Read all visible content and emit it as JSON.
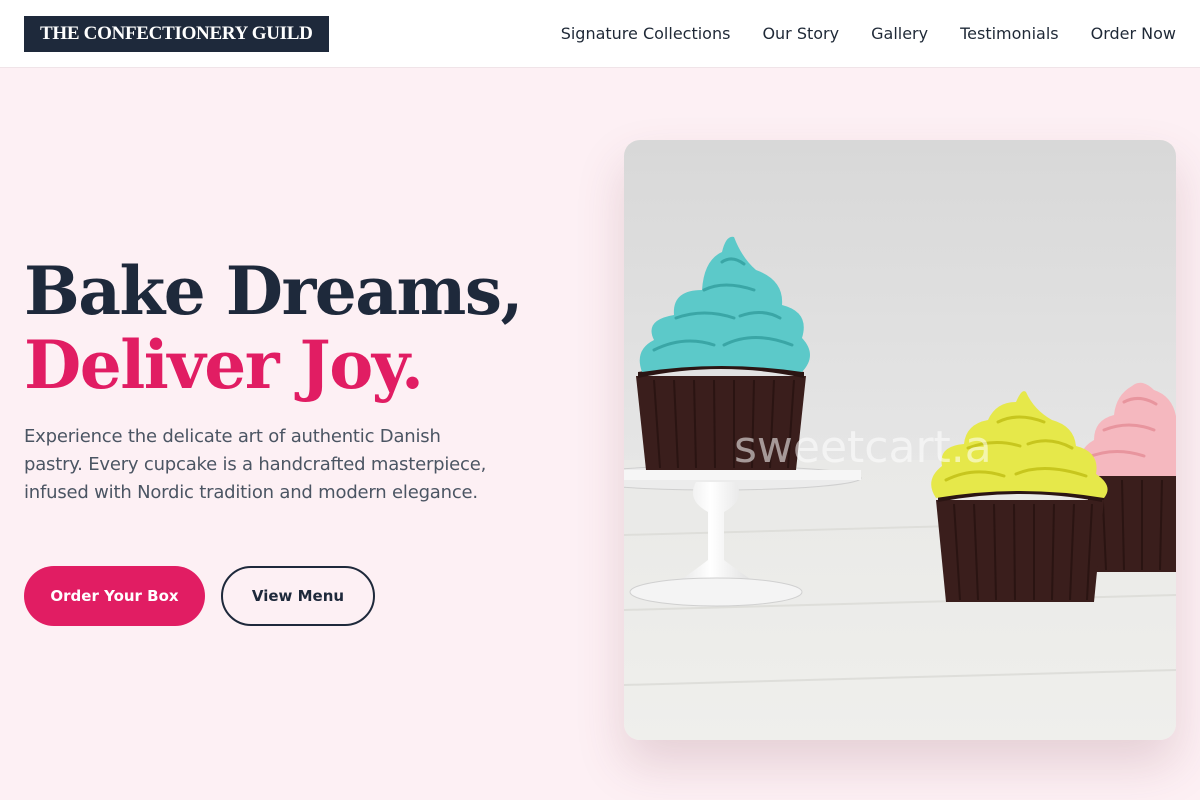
{
  "header": {
    "brand": "THE CONFECTIONERY GUILD",
    "nav": [
      {
        "label": "Signature Collections"
      },
      {
        "label": "Our Story"
      },
      {
        "label": "Gallery"
      },
      {
        "label": "Testimonials"
      },
      {
        "label": "Order Now"
      }
    ]
  },
  "hero": {
    "title_line1": "Bake Dreams,",
    "title_line2": "Deliver Joy.",
    "description": "Experience the delicate art of authentic Danish pastry. Every cupcake is a handcrafted masterpiece, infused with Nordic tradition and modern elegance.",
    "primary_button": "Order Your Box",
    "secondary_button": "View Menu",
    "image": {
      "subject": "cupcakes with teal, yellow and pink frosting on a cake stand",
      "watermark": "sweetcart.a"
    }
  },
  "colors": {
    "accent": "#e11d63",
    "navy": "#1e293b",
    "page_background": "#fdf0f4",
    "frosting_teal": "#5cc9c9",
    "frosting_yellow": "#e6e84a",
    "frosting_pink": "#f5b8bf",
    "cupcake_wrapper": "#3a1e1c"
  }
}
